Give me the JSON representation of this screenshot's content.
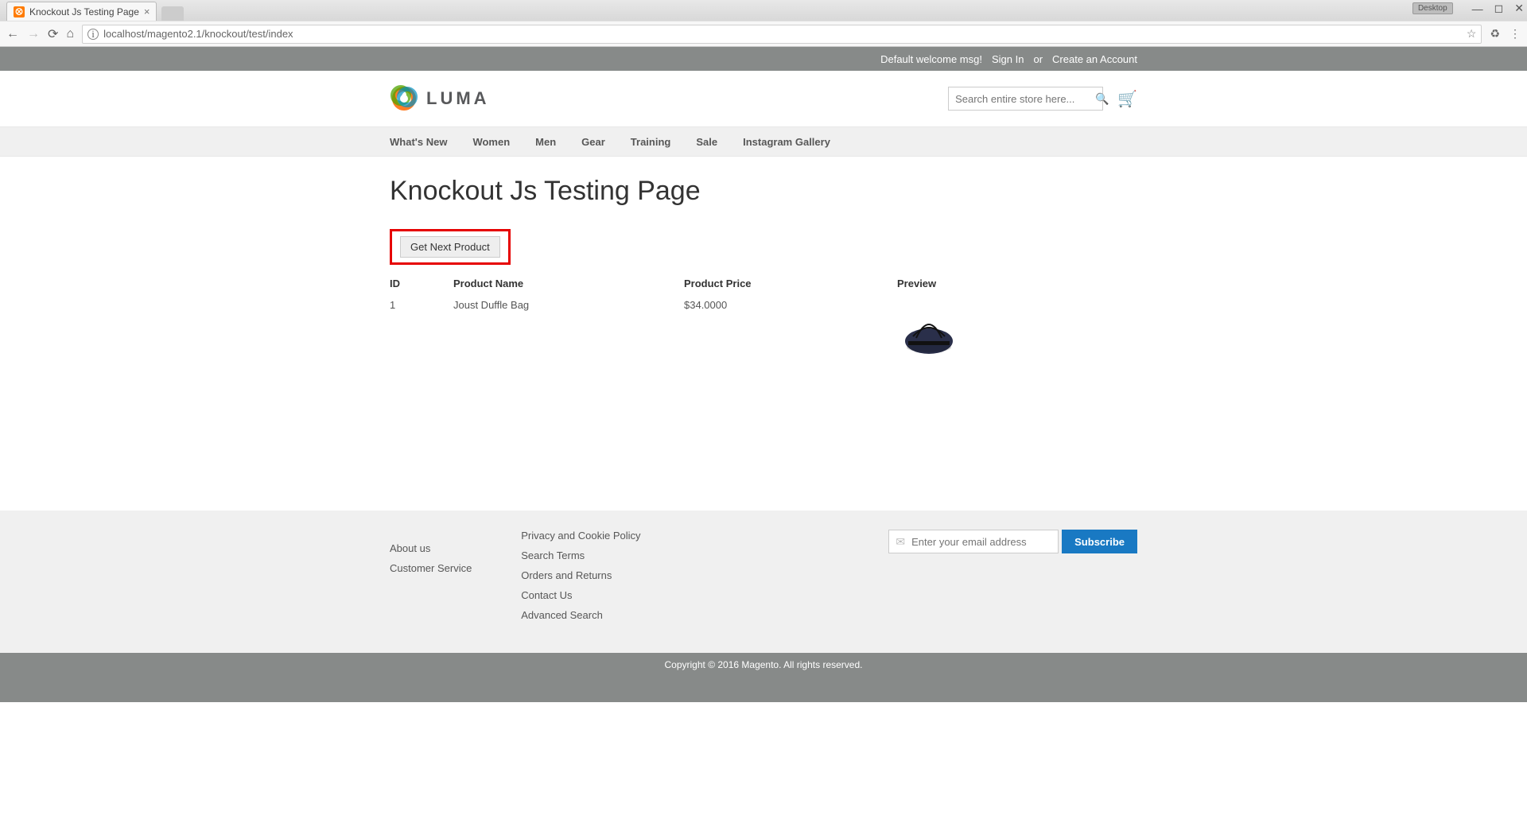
{
  "browser": {
    "tab_title": "Knockout Js Testing Page",
    "url": "localhost/magento2.1/knockout/test/index",
    "desktop_badge": "Desktop"
  },
  "header": {
    "welcome": "Default welcome msg!",
    "sign_in": "Sign In",
    "or": "or",
    "create_account": "Create an Account",
    "logo_text": "LUMA",
    "search_placeholder": "Search entire store here..."
  },
  "nav": {
    "items": [
      {
        "label": "What's New"
      },
      {
        "label": "Women"
      },
      {
        "label": "Men"
      },
      {
        "label": "Gear"
      },
      {
        "label": "Training"
      },
      {
        "label": "Sale"
      },
      {
        "label": "Instagram Gallery"
      }
    ]
  },
  "main": {
    "page_title": "Knockout Js Testing Page",
    "get_next_label": "Get Next Product",
    "table": {
      "headers": {
        "id": "ID",
        "name": "Product Name",
        "price": "Product Price",
        "preview": "Preview"
      },
      "rows": [
        {
          "id": "1",
          "name": "Joust Duffle Bag",
          "price": "$34.0000"
        }
      ]
    }
  },
  "footer": {
    "col1": [
      {
        "label": "About us"
      },
      {
        "label": "Customer Service"
      }
    ],
    "col2": [
      {
        "label": "Privacy and Cookie Policy"
      },
      {
        "label": "Search Terms"
      },
      {
        "label": "Orders and Returns"
      },
      {
        "label": "Contact Us"
      },
      {
        "label": "Advanced Search"
      }
    ],
    "email_placeholder": "Enter your email address",
    "subscribe_label": "Subscribe",
    "copyright": "Copyright © 2016 Magento. All rights reserved."
  }
}
